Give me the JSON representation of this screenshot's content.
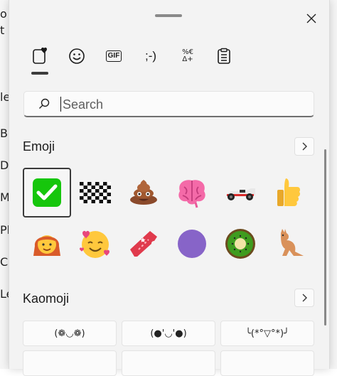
{
  "background": {
    "fragments": [
      "o",
      "t",
      "le",
      "Bo",
      "Di",
      "M",
      "Pl",
      "Co",
      "Le"
    ]
  },
  "picker": {
    "close_icon": "close-icon",
    "tabs": [
      {
        "icon": "favorites-heart-icon"
      },
      {
        "icon": "smiley-icon"
      },
      {
        "label": "GIF"
      },
      {
        "label": ";-)"
      },
      {
        "label": "%€ Δ+"
      },
      {
        "icon": "clipboard-icon"
      }
    ],
    "search": {
      "placeholder": "Search",
      "value": ""
    },
    "emoji_section": {
      "title": "Emoji",
      "items": [
        "check-mark-button",
        "chequered-flag",
        "pile-of-poo",
        "brain",
        "racing-car",
        "thumbs-up",
        "woman-red-hair",
        "smiling-face-with-hearts",
        "ticket",
        "purple-circle",
        "kiwi-fruit",
        "kangaroo"
      ],
      "selected_index": 0
    },
    "kaomoji_section": {
      "title": "Kaomoji",
      "items": [
        "(❁◡❁)",
        "(●'◡'●)",
        "╰(*°▽°*)╯",
        "",
        "",
        ""
      ]
    },
    "colors": {
      "panel": "#f3f3f3",
      "check_green": "#16c60c"
    }
  }
}
